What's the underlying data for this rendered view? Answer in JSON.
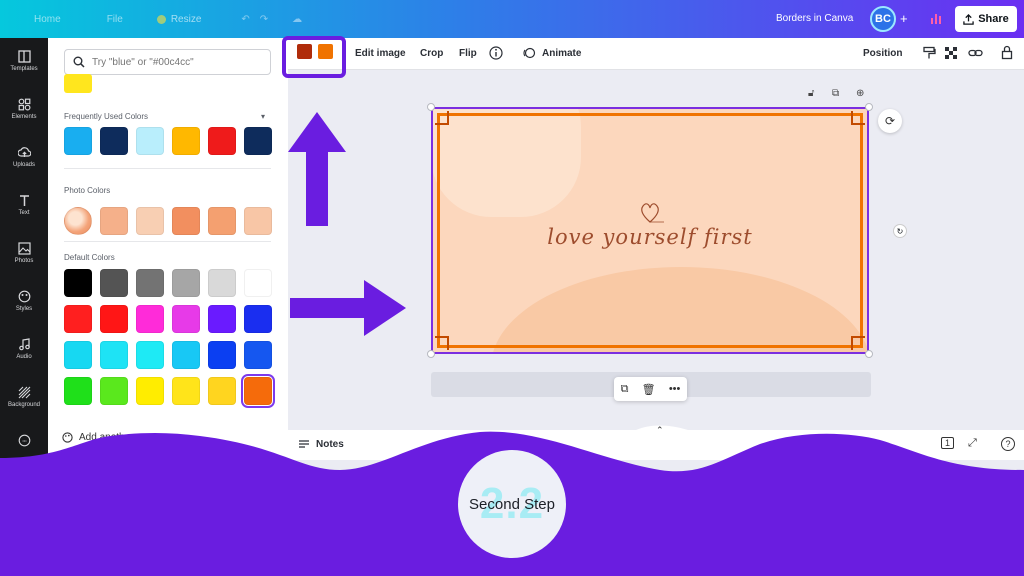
{
  "topbar": {
    "home": "Home",
    "file": "File",
    "resize": "Resize",
    "doc_title": "Borders in Canva",
    "avatar_initials": "BC",
    "share_label": "Share",
    "gradient_colors": [
      "#05c8dd",
      "#2e7ee8",
      "#6b2ff2"
    ]
  },
  "rail": {
    "items": [
      {
        "label": "Templates",
        "icon": "template-icon"
      },
      {
        "label": "Elements",
        "icon": "elements-icon"
      },
      {
        "label": "Uploads",
        "icon": "upload-icon"
      },
      {
        "label": "Text",
        "icon": "text-icon"
      },
      {
        "label": "Photos",
        "icon": "photos-icon"
      },
      {
        "label": "Styles",
        "icon": "styles-icon"
      },
      {
        "label": "Audio",
        "icon": "audio-icon"
      },
      {
        "label": "Background",
        "icon": "background-icon"
      }
    ]
  },
  "panel": {
    "search_placeholder": "Try \"blue\" or \"#00c4cc\"",
    "frequent_title": "Frequently Used Colors",
    "frequent_colors": [
      "#19aef0",
      "#0e2c5c",
      "#b9eefc",
      "#ffb800",
      "#ef1b1b",
      "#0e2c5c"
    ],
    "photo_title": "Photo Colors",
    "photo_colors": [
      "#f5b08a",
      "#f8cfb3",
      "#f28f5f",
      "#f4a070",
      "#f8c6a6"
    ],
    "default_title": "Default Colors",
    "default_colors": [
      [
        "#000000",
        "#545454",
        "#737373",
        "#a6a6a6",
        "#d9d9d9",
        "#ffffff"
      ],
      [
        "#ff1f1f",
        "#ff1616",
        "#ff2bd9",
        "#e73ae8",
        "#6a1bff",
        "#1a2ef0"
      ],
      [
        "#17d8f2",
        "#1ee3f5",
        "#1eeaf5",
        "#18c8f5",
        "#0b3ff2",
        "#1557f0"
      ],
      [
        "#1fe01a",
        "#5ae81d",
        "#ffed00",
        "#ffe41a",
        "#ffd51f",
        "#f56b0b"
      ]
    ],
    "add_color_label": "Add another"
  },
  "toolbar": {
    "chip_colors": [
      "#b02c0a",
      "#f07300"
    ],
    "edit_image": "Edit image",
    "crop": "Crop",
    "flip": "Flip",
    "animate": "Animate",
    "position": "Position"
  },
  "canvas": {
    "text": "love yourself first",
    "border_color": "#f07300",
    "background_color": "#fcd7bd"
  },
  "bottom": {
    "notes_label": "Notes",
    "page_number": "1"
  },
  "overlay": {
    "step_number": "2.2",
    "step_label": "Second Step",
    "accent_color": "#6a1de0"
  }
}
